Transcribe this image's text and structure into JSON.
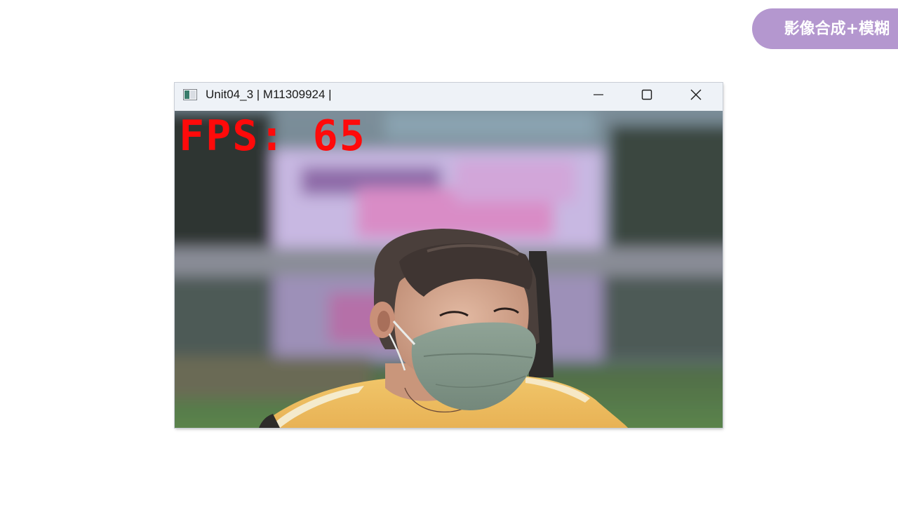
{
  "slide": {
    "badge_text": "影像合成+模糊",
    "badge_color": "#b497cf"
  },
  "window": {
    "title": "Unit04_3 | M11309924 |",
    "app_icon": "window-app-icon",
    "controls": {
      "minimize_icon": "minimize-icon",
      "maximize_icon": "maximize-icon",
      "close_icon": "close-icon"
    }
  },
  "video": {
    "fps_overlay": "FPS: 65",
    "fps_color": "#ff0a0a",
    "description_icon": "camera-feed-image"
  }
}
